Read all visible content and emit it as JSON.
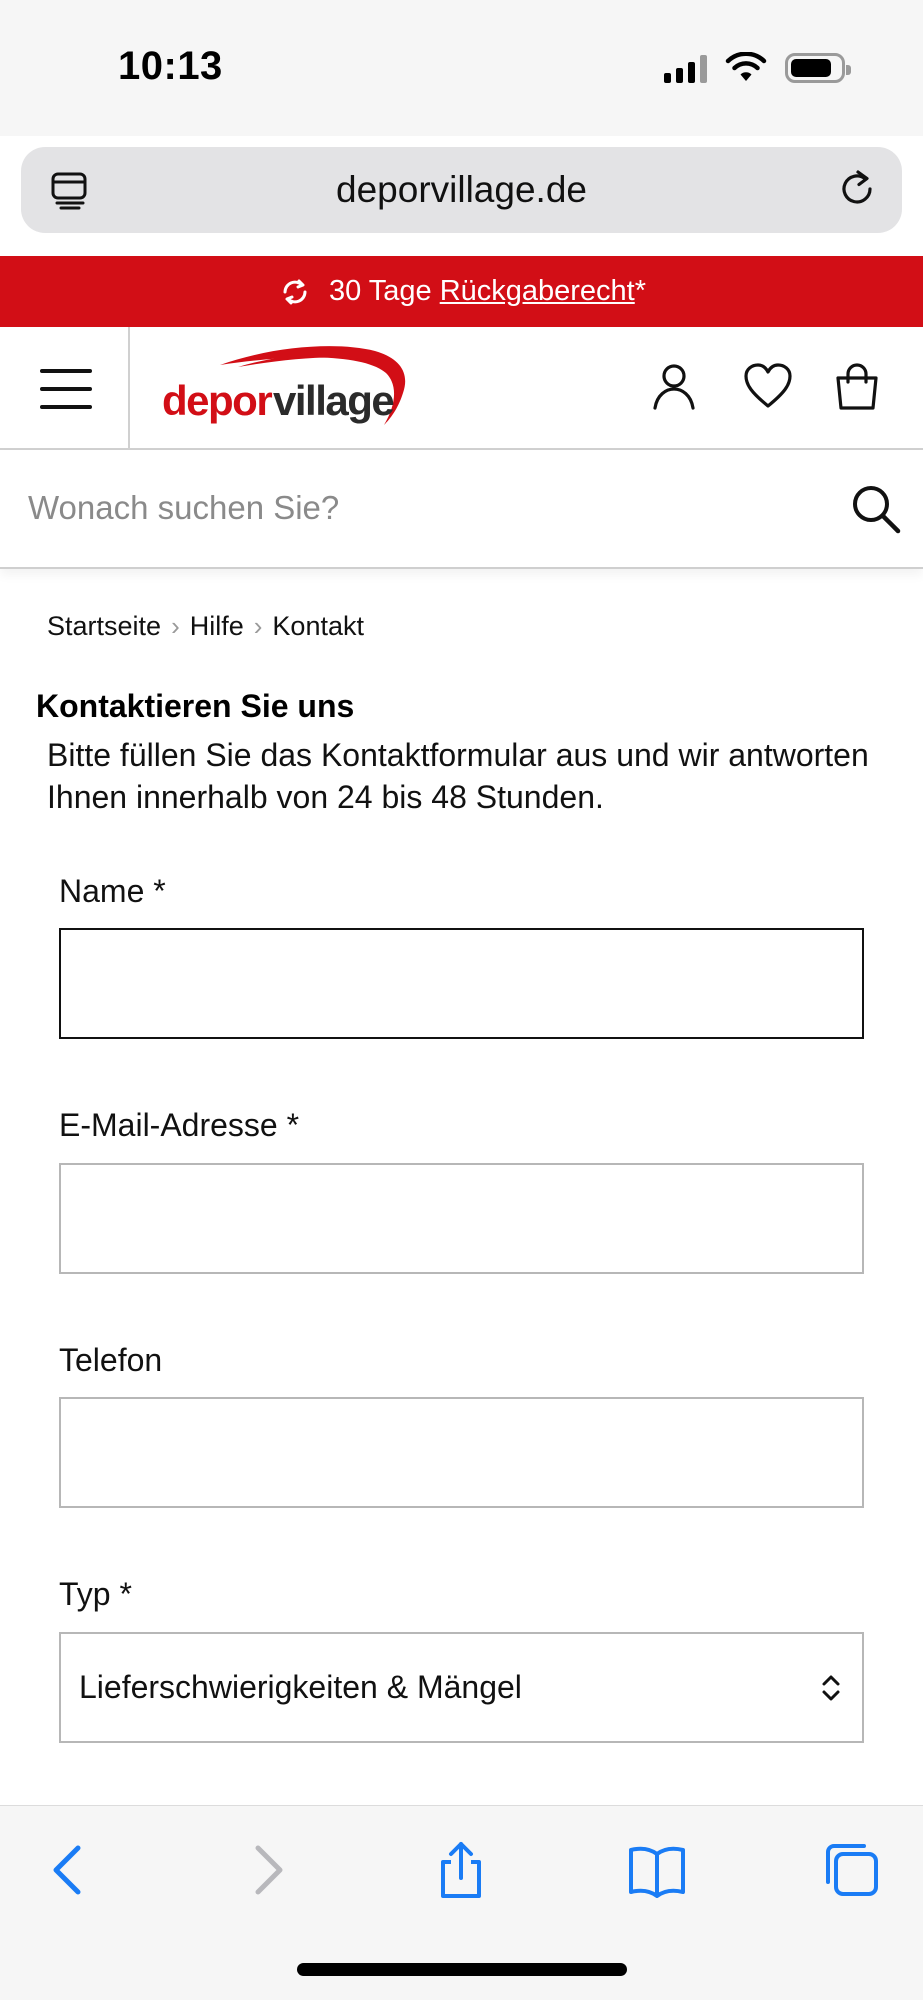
{
  "status_bar": {
    "time": "10:13"
  },
  "browser": {
    "url": "deporvillage.de",
    "icons": {
      "tabs": "tab-overview-icon",
      "reload": "reload-icon"
    }
  },
  "promo_banner": {
    "text_prefix": "30 Tage",
    "link_text": "Rückgaberecht",
    "suffix": "*",
    "background_color": "#d20e16",
    "icon": "return-arrows-icon"
  },
  "header": {
    "logo_text_part1": "depor",
    "logo_text_part2": "village",
    "brand_color": "#d20e16",
    "icons": [
      "menu-icon",
      "account-icon",
      "heart-icon",
      "bag-icon"
    ]
  },
  "search": {
    "placeholder": "Wonach suchen Sie?"
  },
  "breadcrumb": {
    "items": [
      "Startseite",
      "Hilfe",
      "Kontakt"
    ],
    "separator": "›"
  },
  "page": {
    "title": "Kontaktieren Sie uns",
    "intro": "Bitte füllen Sie das Kontaktformular aus und wir antworten Ihnen innerhalb von 24 bis 48 Stunden."
  },
  "form": {
    "name_label": "Name *",
    "name_value": "",
    "email_label": "E-Mail-Adresse *",
    "email_value": "",
    "phone_label": "Telefon",
    "phone_value": "",
    "type_label": "Typ *",
    "type_selected": "Lieferschwierigkeiten & Mängel"
  },
  "toolbar": {
    "icons": [
      "back-icon",
      "forward-icon",
      "share-icon",
      "bookmarks-icon",
      "tabs-icon"
    ],
    "accent_color": "#1a7cf5"
  }
}
